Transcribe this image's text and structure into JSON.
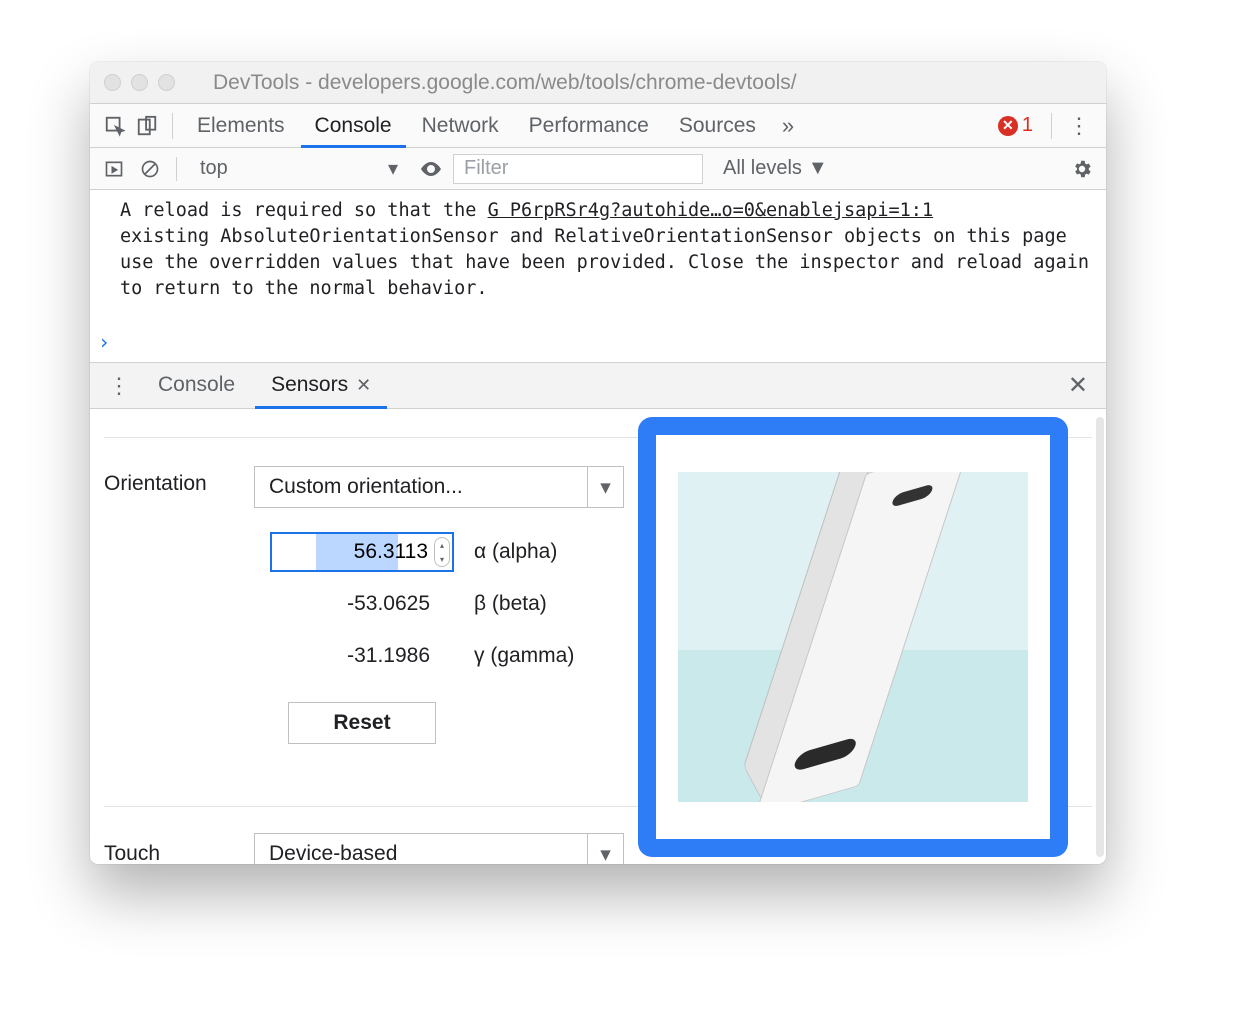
{
  "window": {
    "title": "DevTools - developers.google.com/web/tools/chrome-devtools/"
  },
  "main_tabs": {
    "items": [
      "Elements",
      "Console",
      "Network",
      "Performance",
      "Sources"
    ],
    "active_index": 1,
    "overflow_glyph": "»",
    "error_count": "1"
  },
  "console_toolbar": {
    "context": "top",
    "filter_placeholder": "Filter",
    "levels_label": "All levels"
  },
  "console": {
    "message_pre": "A reload is required so that the ",
    "source_link": "G P6rpRSr4g?autohide…o=0&enablejsapi=1:1",
    "message_post": "existing AbsoluteOrientationSensor and RelativeOrientationSensor objects on this page use the overridden values that have been provided. Close the inspector and reload again to return to the normal behavior."
  },
  "drawer": {
    "tabs": [
      "Console",
      "Sensors"
    ],
    "active_index": 1
  },
  "sensors": {
    "orientation_label": "Orientation",
    "orientation_select": "Custom orientation...",
    "alpha": {
      "value": "56.3113",
      "label": "α (alpha)"
    },
    "beta": {
      "value": "-53.0625",
      "label": "β (beta)"
    },
    "gamma": {
      "value": "-31.1986",
      "label": "γ (gamma)"
    },
    "reset_label": "Reset",
    "touch_label": "Touch",
    "touch_select": "Device-based"
  }
}
